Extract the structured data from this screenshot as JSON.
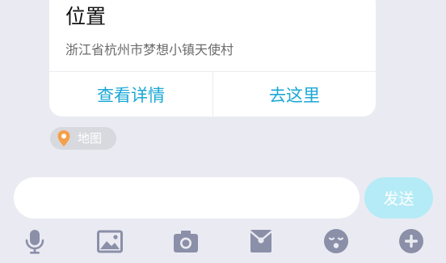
{
  "location_card": {
    "title": "位置",
    "address": "浙江省杭州市梦想小镇天使村",
    "actions": {
      "view_details": "查看详情",
      "go_here": "去这里"
    }
  },
  "map_tag": {
    "label": "地图",
    "icon": "location-pin-icon"
  },
  "composer": {
    "input_value": "",
    "send_label": "发送"
  },
  "toolbar": {
    "icons": [
      "microphone-icon",
      "image-icon",
      "camera-icon",
      "red-envelope-icon",
      "emoji-icon",
      "plus-icon"
    ]
  },
  "colors": {
    "background": "#eaebf2",
    "accent": "#1aa8d6",
    "send_button": "#b5ebf6",
    "icon_gray": "#8b8fa8",
    "pin_orange": "#f5a04a"
  }
}
